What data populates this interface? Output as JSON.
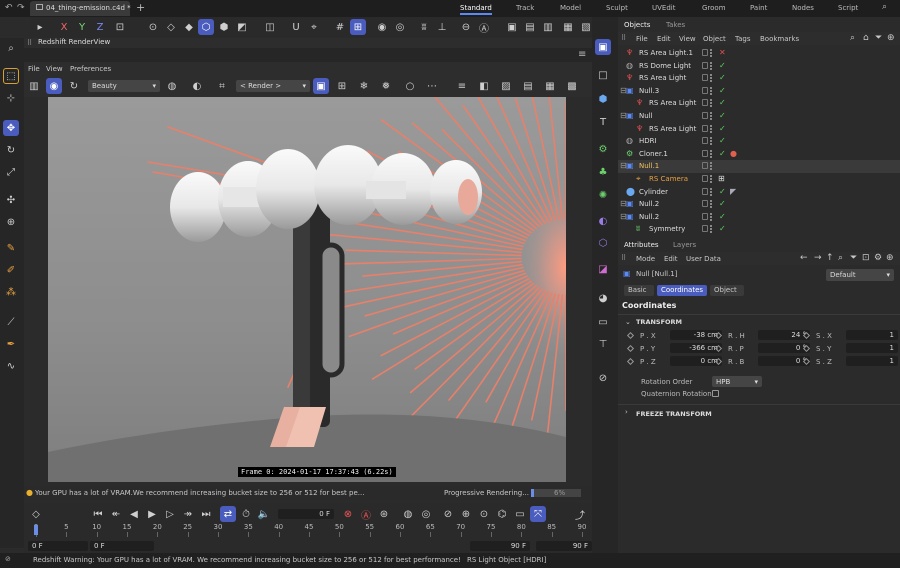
{
  "app": {
    "file_tab": "04_thing-emission.c4d *",
    "layouts": [
      "Standard",
      "Track",
      "Model",
      "Sculpt",
      "UVEdit",
      "Groom",
      "Paint",
      "Nodes",
      "Script"
    ],
    "active_layout": "Standard"
  },
  "toolbar": {
    "axes": [
      "X",
      "Y",
      "Z"
    ]
  },
  "renderview": {
    "title": "Redshift RenderView",
    "menu": [
      "File",
      "View",
      "Preferences"
    ],
    "aov_select": "Beauty",
    "render_select": "< Render >",
    "frame_info": "Frame  0: 2024-01-17 17:37:43  (6.22s)",
    "status_message": "Your GPU has a lot of VRAM.We recommend increasing bucket size to 256 or 512 for best pe...",
    "progress_label": "Progressive Rendering...",
    "progress_percent": "6%",
    "progress_value": 0.06
  },
  "timeline": {
    "current_frame": "0 F",
    "start_field": "0 F",
    "start_field2": "0 F",
    "end_field": "90 F",
    "end_field2": "90 F",
    "ticks": [
      "0",
      "5",
      "10",
      "15",
      "20",
      "25",
      "30",
      "35",
      "40",
      "45",
      "50",
      "55",
      "60",
      "65",
      "70",
      "75",
      "80",
      "85",
      "90"
    ]
  },
  "objects_panel": {
    "tabs": [
      "Objects",
      "Takes"
    ],
    "menu": [
      "File",
      "Edit",
      "View",
      "Object",
      "Tags",
      "Bookmarks"
    ],
    "rows": [
      {
        "name": "RS Area Light.1",
        "indent": 0,
        "icon": "light",
        "status": "x"
      },
      {
        "name": "RS Dome Light",
        "indent": 0,
        "icon": "globe",
        "status": "check"
      },
      {
        "name": "RS Area Light",
        "indent": 0,
        "icon": "light",
        "status": "check"
      },
      {
        "name": "Null.3",
        "indent": 0,
        "icon": "null",
        "status": "check"
      },
      {
        "name": "RS Area Light",
        "indent": 1,
        "icon": "light",
        "status": "check"
      },
      {
        "name": "Null",
        "indent": 0,
        "icon": "null",
        "status": "check"
      },
      {
        "name": "RS Area Light",
        "indent": 1,
        "icon": "light",
        "status": "check"
      },
      {
        "name": "HDRI",
        "indent": 0,
        "icon": "globe",
        "status": "check"
      },
      {
        "name": "Cloner.1",
        "indent": 0,
        "icon": "cloner",
        "status": "check"
      },
      {
        "name": "Null.1",
        "indent": 0,
        "icon": "null",
        "status": "none",
        "highlight": true
      },
      {
        "name": "RS Camera",
        "indent": 1,
        "icon": "camera",
        "status": "none",
        "orange": true
      },
      {
        "name": "Cylinder",
        "indent": 0,
        "icon": "cylinder",
        "status": "check"
      },
      {
        "name": "Null.2",
        "indent": 0,
        "icon": "null",
        "status": "check"
      },
      {
        "name": "Null.2",
        "indent": 0,
        "icon": "null",
        "status": "check"
      },
      {
        "name": "Symmetry",
        "indent": 1,
        "icon": "symmetry",
        "status": "check"
      }
    ]
  },
  "attributes_panel": {
    "tabs": [
      "Attributes",
      "Layers"
    ],
    "menu": [
      "Mode",
      "Edit",
      "User Data"
    ],
    "object_label": "Null [Null.1]",
    "preset": "Default",
    "subtabs": [
      "Basic",
      "Coordinates",
      "Object"
    ],
    "active_subtab": "Coordinates",
    "section_title": "Coordinates",
    "transform_header": "TRANSFORM",
    "freeze_header": "FREEZE TRANSFORM",
    "pos": [
      {
        "label": "P . X",
        "value": "-38 cm"
      },
      {
        "label": "P . Y",
        "value": "-366 cm"
      },
      {
        "label": "P . Z",
        "value": "0 cm"
      }
    ],
    "rot": [
      {
        "label": "R . H",
        "value": "24 °"
      },
      {
        "label": "R . P",
        "value": "0 °"
      },
      {
        "label": "R . B",
        "value": "0 °"
      }
    ],
    "scale": [
      {
        "label": "S . X",
        "value": "1"
      },
      {
        "label": "S . Y",
        "value": "1"
      },
      {
        "label": "S . Z",
        "value": "1"
      }
    ],
    "rotation_order_label": "Rotation Order",
    "rotation_order_value": "HPB",
    "quaternion_label": "Quaternion Rotation"
  },
  "bottom_status": {
    "message": "Redshift Warning: Your GPU has a lot of VRAM. We recommend increasing bucket size to 256 or 512 for best performance!",
    "selection": "RS Light Object [HDRI]"
  },
  "colors": {
    "accent": "#4a5cbd",
    "check": "#5fd05f",
    "orange": "#e8a040",
    "ray": "#e8806a"
  }
}
